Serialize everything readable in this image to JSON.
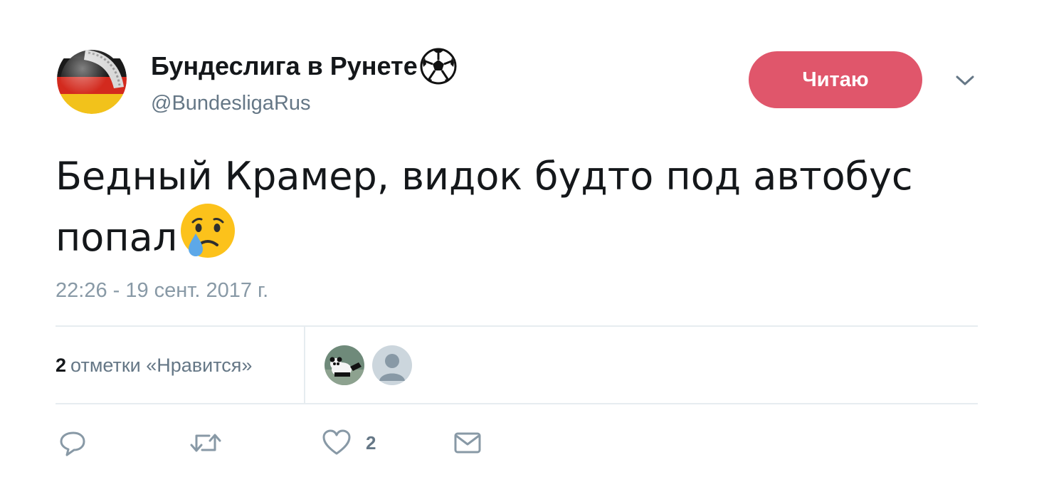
{
  "author": {
    "display_name": "Бундеслига в Рунете",
    "handle": "@BundesligaRus",
    "avatar_icon": "germany-flag-ball-avatar",
    "name_emoji": "soccer-ball-icon"
  },
  "follow_button": {
    "label": "Читаю",
    "color": "#e0566b"
  },
  "menu": {
    "icon": "chevron-down-icon"
  },
  "tweet": {
    "text_line1": "Бедный Крамер, видок будто под автобус",
    "text_line2": "попал",
    "emoji": "crying-face-icon",
    "timestamp": "22:26 - 19 сент. 2017 г."
  },
  "stats": {
    "likes_count": "2",
    "likes_label": "отметки «Нравится»",
    "likers": [
      {
        "icon": "panda-avatar"
      },
      {
        "icon": "default-user-avatar"
      }
    ]
  },
  "actions": {
    "reply_icon": "reply-icon",
    "retweet_icon": "retweet-icon",
    "like_icon": "heart-icon",
    "like_count": "2",
    "dm_icon": "envelope-icon"
  },
  "colors": {
    "text": "#14171a",
    "secondary": "#657786",
    "timestamp": "#8899a6",
    "divider": "#e6ecf0",
    "action_icon": "#8899a6"
  }
}
